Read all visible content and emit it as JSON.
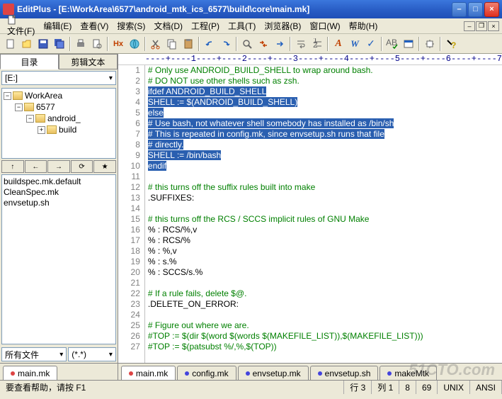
{
  "title": "EditPlus - [E:\\WorkArea\\6577\\android_mtk_ics_6577\\build\\core\\main.mk]",
  "menu": {
    "file": "文件(F)",
    "edit": "编辑(E)",
    "view": "查看(V)",
    "search": "搜索(S)",
    "doc": "文档(D)",
    "project": "工程(P)",
    "tools": "工具(T)",
    "browser": "浏览器(B)",
    "window": "窗口(W)",
    "help": "帮助(H)"
  },
  "sidetabs": {
    "dir": "目录",
    "clip": "剪辑文本"
  },
  "drive": "[E:]",
  "tree": {
    "root": "WorkArea",
    "l1": "6577",
    "l2": "android_",
    "l3": "build"
  },
  "nav": {
    "up": "↑",
    "back": "←",
    "fwd": "→",
    "refresh": "⟳",
    "star": "★"
  },
  "files": [
    "buildspec.mk.default",
    "CleanSpec.mk",
    "envsetup.sh"
  ],
  "filter": {
    "label": "所有文件",
    "pattern": "(*.*)"
  },
  "ruler": "----+----1----+----2----+----3----+----4----+----5----+----6----+----7",
  "code": [
    {
      "n": 1,
      "t": "# Only use ANDROID_BUILD_SHELL to wrap around bash.",
      "cls": "comment"
    },
    {
      "n": 2,
      "t": "# DO NOT use other shells such as zsh.",
      "cls": "comment"
    },
    {
      "n": 3,
      "t": "ifdef ANDROID_BUILD_SHELL",
      "cls": "hl"
    },
    {
      "n": 4,
      "t": "SHELL := $(ANDROID_BUILD_SHELL)",
      "cls": "hl"
    },
    {
      "n": 5,
      "t": "else",
      "cls": "hl"
    },
    {
      "n": 6,
      "t": "# Use bash, not whatever shell somebody has installed as /bin/sh",
      "cls": "hl"
    },
    {
      "n": 7,
      "t": "# This is repeated in config.mk, since envsetup.sh runs that file",
      "cls": "hl"
    },
    {
      "n": 8,
      "t": "# directly.",
      "cls": "hl"
    },
    {
      "n": 9,
      "t": "SHELL := /bin/bash",
      "cls": "hl"
    },
    {
      "n": 10,
      "t": "endif",
      "cls": "hl"
    },
    {
      "n": 11,
      "t": "",
      "cls": ""
    },
    {
      "n": 12,
      "t": "# this turns off the suffix rules built into make",
      "cls": "comment"
    },
    {
      "n": 13,
      "t": ".SUFFIXES:",
      "cls": ""
    },
    {
      "n": 14,
      "t": "",
      "cls": ""
    },
    {
      "n": 15,
      "t": "# this turns off the RCS / SCCS implicit rules of GNU Make",
      "cls": "comment"
    },
    {
      "n": 16,
      "t": "% : RCS/%,v",
      "cls": ""
    },
    {
      "n": 17,
      "t": "% : RCS/%",
      "cls": ""
    },
    {
      "n": 18,
      "t": "% : %,v",
      "cls": ""
    },
    {
      "n": 19,
      "t": "% : s.%",
      "cls": ""
    },
    {
      "n": 20,
      "t": "% : SCCS/s.%",
      "cls": ""
    },
    {
      "n": 21,
      "t": "",
      "cls": ""
    },
    {
      "n": 22,
      "t": "# If a rule fails, delete $@.",
      "cls": "comment"
    },
    {
      "n": 23,
      "t": ".DELETE_ON_ERROR:",
      "cls": ""
    },
    {
      "n": 24,
      "t": "",
      "cls": ""
    },
    {
      "n": 25,
      "t": "# Figure out where we are.",
      "cls": "comment"
    },
    {
      "n": 26,
      "t": "#TOP := $(dir $(word $(words $(MAKEFILE_LIST)),$(MAKEFILE_LIST)))",
      "cls": "comment"
    },
    {
      "n": 27,
      "t": "#TOP := $(patsubst %/,%,$(TOP))",
      "cls": "comment"
    }
  ],
  "doctabs": [
    {
      "label": "main.mk",
      "active": true,
      "dot": "red"
    },
    {
      "label": "config.mk",
      "active": false,
      "dot": "blue"
    },
    {
      "label": "envsetup.mk",
      "active": false,
      "dot": "blue"
    },
    {
      "label": "envsetup.sh",
      "active": false,
      "dot": "blue"
    },
    {
      "label": "makeMtk",
      "active": false,
      "dot": "blue"
    }
  ],
  "sidedoc": "main.mk",
  "status": {
    "help": "要查看帮助，请按 F1",
    "line": "行 3",
    "col": "列 1",
    "c2": "8",
    "c3": "69",
    "os": "UNIX",
    "enc": "ANSI"
  },
  "watermark": "51CTO.com"
}
